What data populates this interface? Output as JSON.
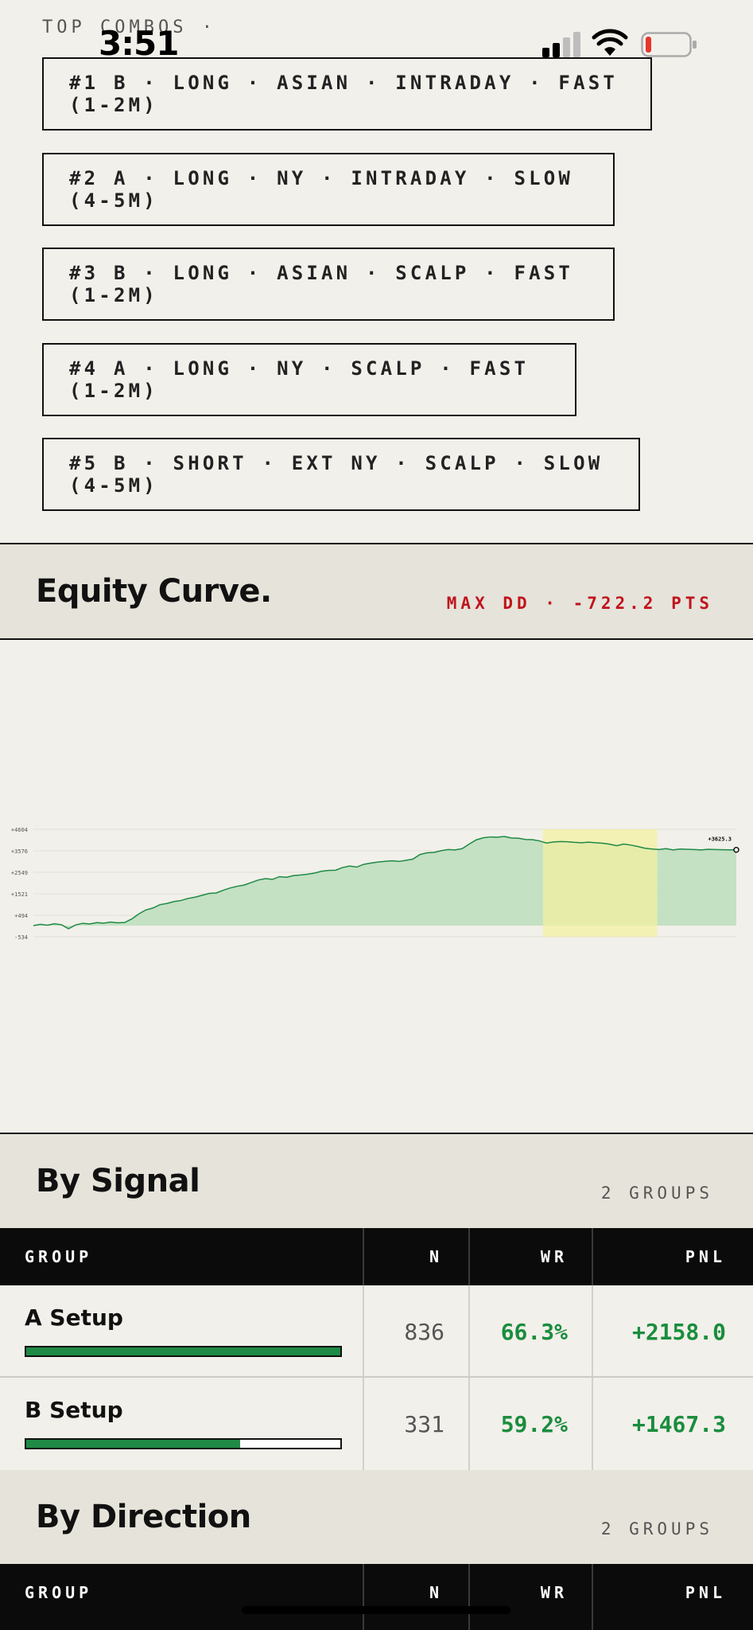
{
  "status_bar": {
    "time": "3:51"
  },
  "top_combos": {
    "kicker": "TOP COMBOS ·",
    "items": [
      "#1 B · LONG · ASIAN · INTRADAY · FAST (1-2M)",
      "#2 A · LONG · NY · INTRADAY · SLOW (4-5M)",
      "#3 B · LONG · ASIAN · SCALP · FAST (1-2M)",
      "#4 A · LONG · NY · SCALP · FAST (1-2M)",
      "#5 B · SHORT · EXT NY · SCALP · SLOW (4-5M)"
    ]
  },
  "equity": {
    "title": "Equity Curve.",
    "max_dd": "MAX DD · -722.2 PTS",
    "colors": {
      "line": "#1f8a45",
      "area": "#bfdfbf",
      "highlight": "#f4f1a0",
      "dd": "#c0141c"
    }
  },
  "chart_data": {
    "type": "area",
    "y_tick_labels": [
      "+4604",
      "+3576",
      "+2549",
      "+1521",
      "+494",
      "-534"
    ],
    "ylim": [
      -534,
      4604
    ],
    "end_label": "+3625.3",
    "x": [
      0,
      4,
      8,
      12,
      16,
      20,
      24,
      28,
      32,
      36,
      40,
      44,
      48,
      52,
      56,
      60,
      64,
      68,
      72,
      76,
      80,
      84,
      88,
      92,
      96,
      100,
      104,
      108,
      112,
      116,
      120,
      124,
      128,
      132,
      136,
      140,
      144,
      148,
      152,
      156,
      160,
      164,
      168,
      172,
      176,
      180,
      184,
      188,
      192,
      196,
      200,
      204,
      208,
      212,
      216,
      220,
      224,
      228,
      232,
      236,
      240,
      244,
      248,
      252,
      256,
      260,
      264,
      268,
      272,
      276,
      280,
      284,
      288,
      292,
      296,
      300,
      304,
      308,
      312,
      316,
      320,
      324,
      328,
      332,
      336,
      340,
      344,
      348,
      352,
      356,
      360,
      364,
      368,
      372,
      376,
      380,
      384,
      388,
      392,
      396,
      400
    ],
    "values": [
      0,
      60,
      20,
      90,
      40,
      -150,
      30,
      110,
      80,
      140,
      120,
      170,
      130,
      150,
      320,
      560,
      750,
      840,
      1000,
      1060,
      1150,
      1200,
      1300,
      1360,
      1450,
      1540,
      1560,
      1690,
      1800,
      1880,
      1940,
      2060,
      2180,
      2250,
      2210,
      2340,
      2310,
      2390,
      2420,
      2460,
      2510,
      2600,
      2640,
      2650,
      2780,
      2850,
      2800,
      2930,
      2990,
      3040,
      3070,
      3100,
      3070,
      3120,
      3180,
      3400,
      3480,
      3500,
      3580,
      3640,
      3620,
      3680,
      3900,
      4100,
      4200,
      4240,
      4230,
      4260,
      4190,
      4180,
      4120,
      4110,
      4050,
      3950,
      4000,
      4020,
      4010,
      3980,
      3960,
      3990,
      3960,
      3940,
      3890,
      3820,
      3900,
      3850,
      3780,
      3700,
      3660,
      3640,
      3680,
      3620,
      3660,
      3650,
      3640,
      3620,
      3650,
      3640,
      3630,
      3625,
      3625
    ],
    "drawdown_window": [
      290,
      355
    ],
    "grid": true
  },
  "by_signal": {
    "title": "By Signal",
    "meta": "2 GROUPS",
    "columns": [
      "GROUP",
      "N",
      "WR",
      "PNL"
    ],
    "rows": [
      {
        "name": "A Setup",
        "n": "836",
        "wr": "66.3%",
        "pnl": "+2158.0",
        "share": 1.0
      },
      {
        "name": "B Setup",
        "n": "331",
        "wr": "59.2%",
        "pnl": "+1467.3",
        "share": 0.68
      }
    ]
  },
  "by_direction": {
    "title": "By Direction",
    "meta": "2 GROUPS",
    "columns": [
      "GROUP",
      "N",
      "WR",
      "PNL"
    ]
  }
}
